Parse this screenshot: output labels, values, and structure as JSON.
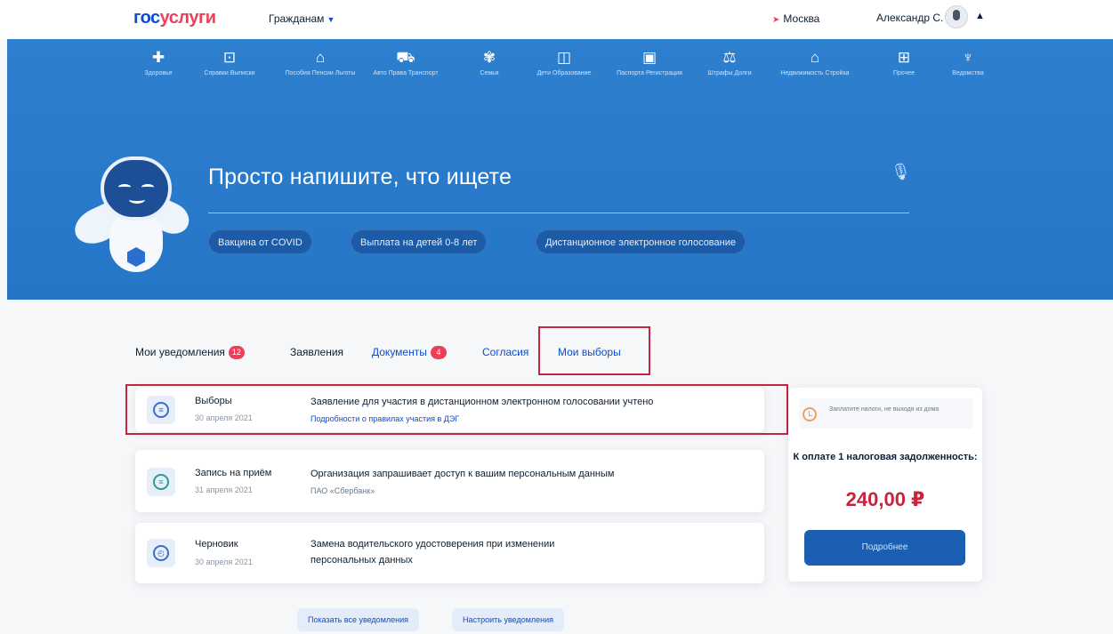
{
  "header": {
    "logo_part1": "гос",
    "logo_part2": "услуги",
    "role": "Гражданам",
    "city": "Москва",
    "user": "Александр С."
  },
  "categories": [
    {
      "icon": "health-icon",
      "glyph": "✚",
      "label": "Здоровье"
    },
    {
      "icon": "pension-icon",
      "glyph": "⊡",
      "label": "Справки Выписки"
    },
    {
      "icon": "benefits-icon",
      "glyph": "⌂",
      "label": "Пособия Пенсии Льготы"
    },
    {
      "icon": "car-icon",
      "glyph": "⛟",
      "label": "Авто Права Транспорт"
    },
    {
      "icon": "family-icon",
      "glyph": "✾",
      "label": "Семья"
    },
    {
      "icon": "children-icon",
      "glyph": "◫",
      "label": "Дети Образование"
    },
    {
      "icon": "passport-icon",
      "glyph": "▣",
      "label": "Паспорта Регистрация"
    },
    {
      "icon": "fines-icon",
      "glyph": "⚖",
      "label": "Штрафы Долги"
    },
    {
      "icon": "property-icon",
      "glyph": "⌂",
      "label": "Недвижимость Стройка"
    },
    {
      "icon": "other-icon",
      "glyph": "⊞",
      "label": "Прочее"
    },
    {
      "icon": "agencies-icon",
      "glyph": "♆",
      "label": "Ведомства"
    }
  ],
  "search": {
    "prompt": "Просто напишите, что ищете",
    "chips": [
      "Вакцина от COVID",
      "Выплата на детей 0-8 лет",
      "Дистанционное электронное голосование"
    ]
  },
  "tabs": [
    {
      "label": "Мои уведомления",
      "count": "12",
      "style": "dark"
    },
    {
      "label": "Заявления",
      "count": "",
      "style": "dark"
    },
    {
      "label": "Документы",
      "count": "4",
      "style": "link"
    },
    {
      "label": "Согласия",
      "count": "",
      "style": "link"
    },
    {
      "label": "Мои выборы",
      "count": "",
      "style": "link"
    }
  ],
  "notifications": [
    {
      "icon": "elections-icon",
      "kind": "Выборы",
      "date": "30 апреля 2021",
      "text": "Заявление для участия в дистанционном электронном голосовании учтено",
      "sub": "Подробности о правилах участия в ДЭГ",
      "color": "#3a6fc9"
    },
    {
      "icon": "appointment-icon",
      "kind": "Запись на приём",
      "date": "31 апреля 2021",
      "text": "Организация запрашивает доступ к вашим персональным данным",
      "sub": "ПАО «Сбербанк»",
      "color": "#2b9c8a"
    },
    {
      "icon": "draft-icon",
      "kind": "Черновик",
      "date": "30 апреля 2021",
      "text": "Замена водительского удостоверения при изменении персональных данных",
      "sub": "",
      "color": "#3a6fc9"
    }
  ],
  "buttons": {
    "show_all": "Показать все уведомления",
    "configure": "Настроить уведомления"
  },
  "tax_panel": {
    "note": "Заплатите налоги, не выходя из дома",
    "title": "К оплате 1 налоговая задолженность:",
    "amount": "240,00 ₽",
    "button": "Подробнее"
  }
}
